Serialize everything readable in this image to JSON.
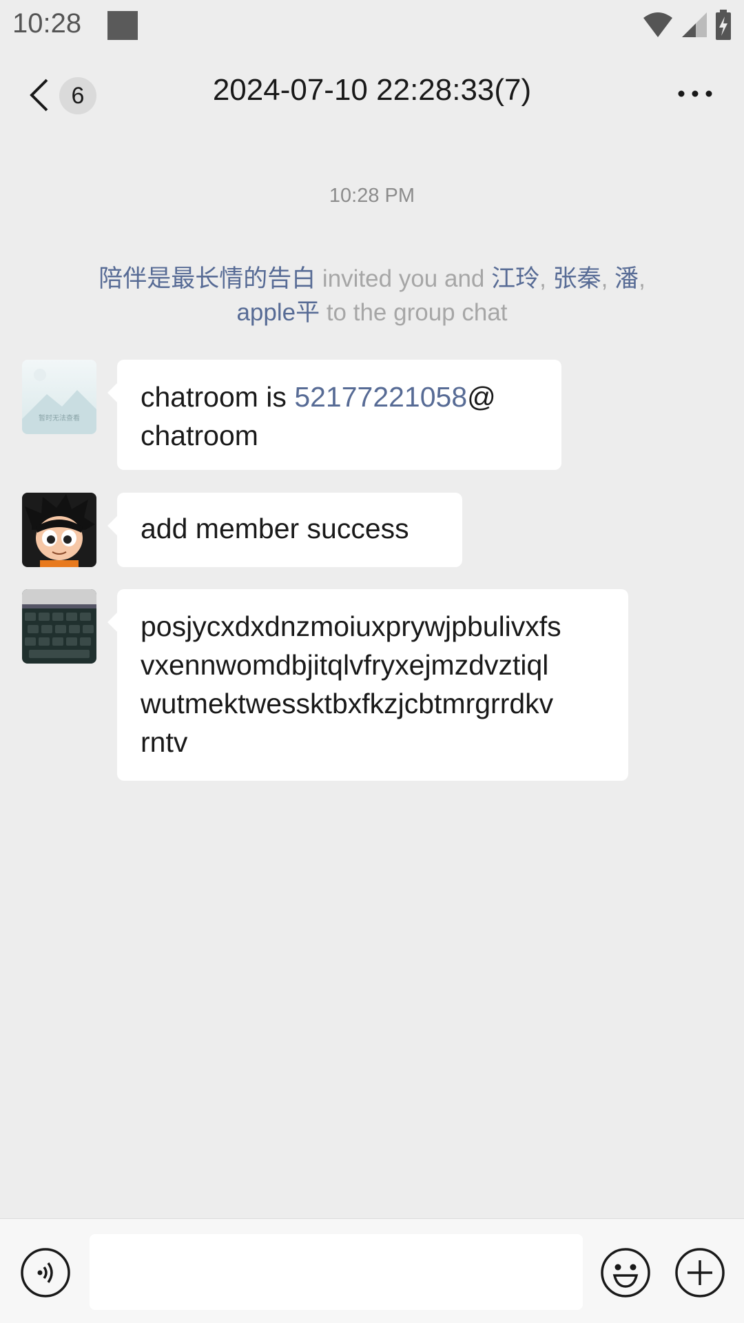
{
  "status_bar": {
    "time": "10:28"
  },
  "nav": {
    "badge": "6",
    "title": "2024-07-10 22:28:33(7)"
  },
  "chat": {
    "timestamp": "10:28 PM",
    "system": {
      "inviter": "陪伴是最长情的告白",
      "text1": " invited you and ",
      "m1": "江玲",
      "sep1": ", ",
      "m2": "张秦",
      "sep2": ", ",
      "m3": "潘",
      "sep3": ",",
      "m4": "apple平",
      "text2": " to the group chat"
    },
    "messages": [
      {
        "prefix": "chatroom is ",
        "link": "52177221058",
        "suffix": "@",
        "line2": "chatroom"
      },
      {
        "text": "add member success"
      },
      {
        "lines": [
          "posjycxdxdnzmoiuxprywjpbulivxfs",
          "vxennwomdbjitqlvfryxejmzdvztiql",
          "wutmektwessktbxfkzjcbtmrgrrdkv",
          "rntv"
        ]
      }
    ],
    "placeholder_avatar_text": "暂时无法查看"
  },
  "colors": {
    "background": "#ededed",
    "link": "#576b95",
    "bubble": "#ffffff"
  }
}
